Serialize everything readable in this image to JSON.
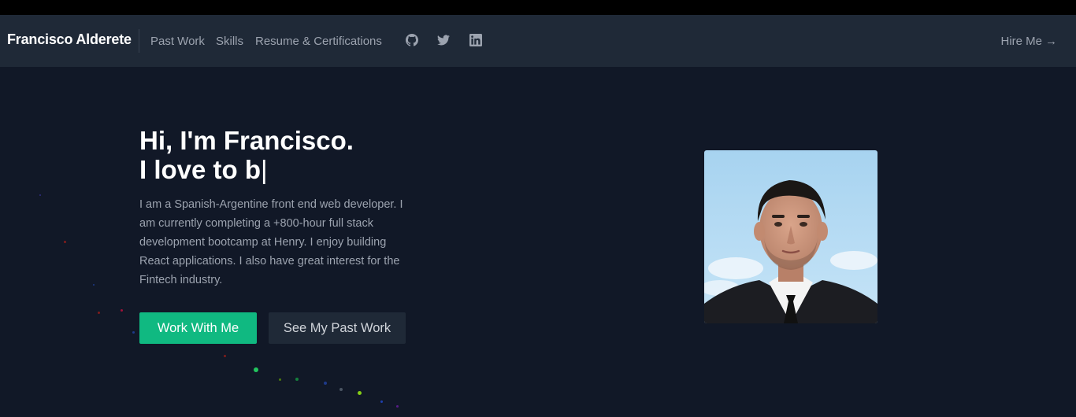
{
  "nav": {
    "brand": "Francisco Alderete",
    "links": [
      "Past Work",
      "Skills",
      "Resume & Certifications"
    ],
    "icons": [
      "github-icon",
      "twitter-icon",
      "linkedin-icon"
    ],
    "hire_label": "Hire Me",
    "hire_arrow": "→"
  },
  "hero": {
    "title_line1": "Hi, I'm Francisco.",
    "title_line2": "I love to b",
    "cursor": "|",
    "description": "I am a Spanish-Argentine front end web developer. I am currently completing a +800-hour full stack development bootcamp at Henry. I enjoy building React applications. I also have great interest for the Fintech industry.",
    "primary_button": "Work With Me",
    "secondary_button": "See My Past Work"
  },
  "colors": {
    "background": "#111827",
    "navbar": "#1f2937",
    "accent": "#10b981",
    "text_muted": "#9ca3af"
  }
}
